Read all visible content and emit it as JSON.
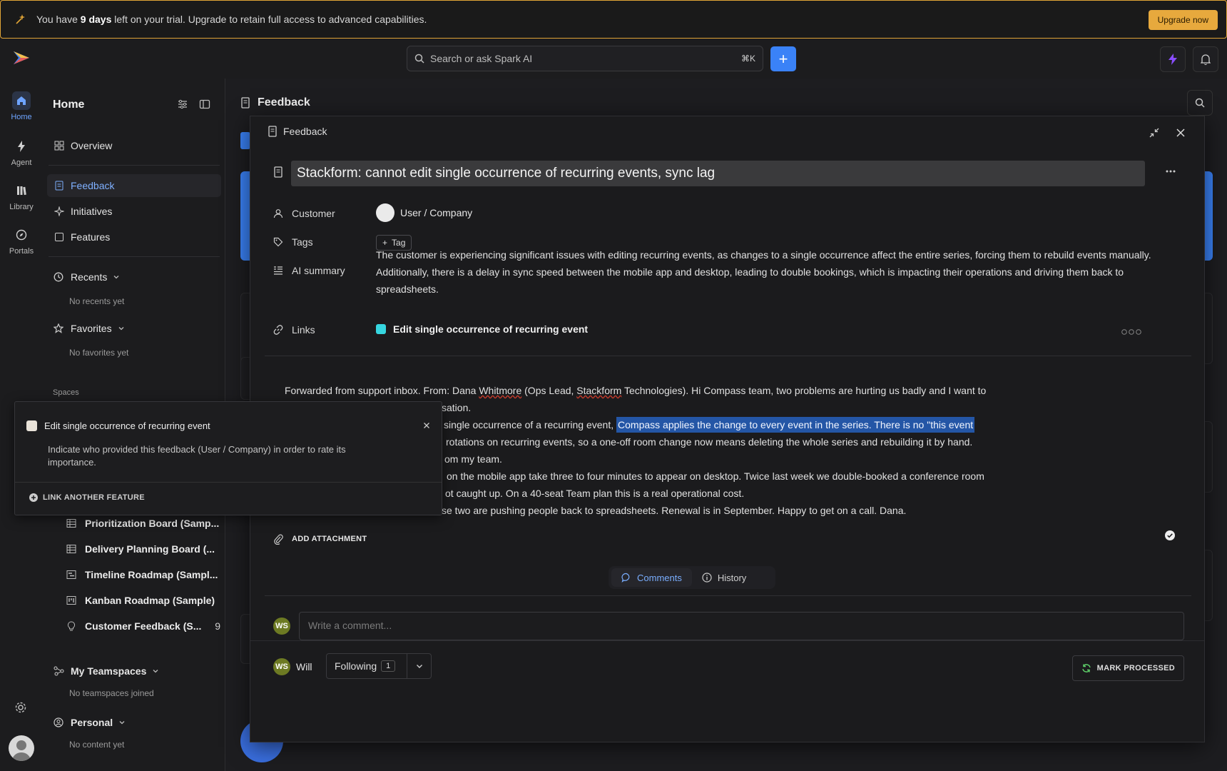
{
  "trial": {
    "prefix": "You have ",
    "days": "9 days",
    "suffix": " left on your trial. Upgrade to retain full access to advanced capabilities.",
    "upgrade_label": "Upgrade now"
  },
  "search": {
    "placeholder": "Search or ask Spark AI",
    "shortcut": "⌘K"
  },
  "rail": [
    {
      "label": "Home",
      "icon": "home-icon",
      "active": true
    },
    {
      "label": "Agent",
      "icon": "bolt-icon"
    },
    {
      "label": "Library",
      "icon": "library-icon"
    },
    {
      "label": "Portals",
      "icon": "compass-icon"
    }
  ],
  "sidebar": {
    "title": "Home",
    "items": {
      "overview": "Overview",
      "feedback": "Feedback",
      "initiatives": "Initiatives",
      "features": "Features"
    },
    "recents": {
      "label": "Recents",
      "empty": "No recents yet"
    },
    "favorites": {
      "label": "Favorites",
      "empty": "No favorites yet"
    },
    "spaces_label": "Spaces",
    "spaces": [
      {
        "label": "Prioritization Board (Samp...",
        "icon": "table-icon"
      },
      {
        "label": "Delivery Planning Board (...",
        "icon": "table-icon"
      },
      {
        "label": "Timeline Roadmap (Sampl...",
        "icon": "timeline-icon"
      },
      {
        "label": "Kanban Roadmap (Sample)",
        "icon": "kanban-icon"
      },
      {
        "label": "Customer Feedback (S...",
        "icon": "bulb-icon",
        "count": "9"
      }
    ],
    "teamspaces": {
      "label": "My Teamspaces",
      "empty": "No teamspaces joined"
    },
    "personal": {
      "label": "Personal",
      "empty": "No content yet"
    }
  },
  "main": {
    "title": "Feedback"
  },
  "modal": {
    "header": "Feedback",
    "title": "Stackform: cannot edit single occurrence of recurring events, sync lag",
    "props": {
      "customer_label": "Customer",
      "customer_value": "User / Company",
      "tags_label": "Tags",
      "tag_button": "Tag",
      "summary_label": "AI summary",
      "summary": "The customer is experiencing significant issues with editing recurring events, as changes to a single occurrence affect the entire series, forcing them to rebuild events manually. Additionally, there is a delay in sync speed between the mobile app and desktop, leading to double bookings, which is impacting their operations and driving them back to spreadsheets.",
      "links_label": "Links",
      "link_value": "Edit single occurrence of recurring event"
    },
    "body": {
      "line1a": "Forwarded from support inbox. From: Dana ",
      "line1b": "Whitmore",
      "line1c": " (Ops Lead, ",
      "line1d": "Stackform",
      "line1e": " Technologies). Hi Compass team, two problems are hurting us badly and I want to",
      "line2": "sation.",
      "line3a": "single occurrence of a recurring event, ",
      "line3b": "Compass applies the change to every event in the series. There is no \"this event",
      "line4": "rotations on recurring events, so a one-off room change now means deleting the whole series and rebuilding it by hand.",
      "line5": "om my team.",
      "line6": "on the mobile app take three to four minutes to appear on desktop. Twice last week we double-booked a conference room",
      "line7": "ot caught up. On a 40-seat Team plan this is a real operational cost.",
      "line8": "se two are pushing people back to spreadsheets. Renewal is in September. Happy to get on a call. Dana."
    },
    "add_attachment": "ADD ATTACHMENT",
    "tabs": {
      "comments": "Comments",
      "history": "History"
    },
    "comment_placeholder": "Write a comment...",
    "footer": {
      "initials": "WS",
      "user": "Will",
      "following": "Following",
      "following_count": "1",
      "mark_processed": "MARK PROCESSED"
    }
  },
  "popover": {
    "title": "Edit single occurrence of recurring event",
    "description": "Indicate who provided this feedback (User / Company) in order to rate its importance.",
    "link_another": "LINK ANOTHER FEATURE"
  },
  "colors": {
    "accent": "#3a82f7",
    "trial_border": "#e0a436",
    "upgrade": "#e7a93d",
    "highlight": "#2456a6"
  }
}
